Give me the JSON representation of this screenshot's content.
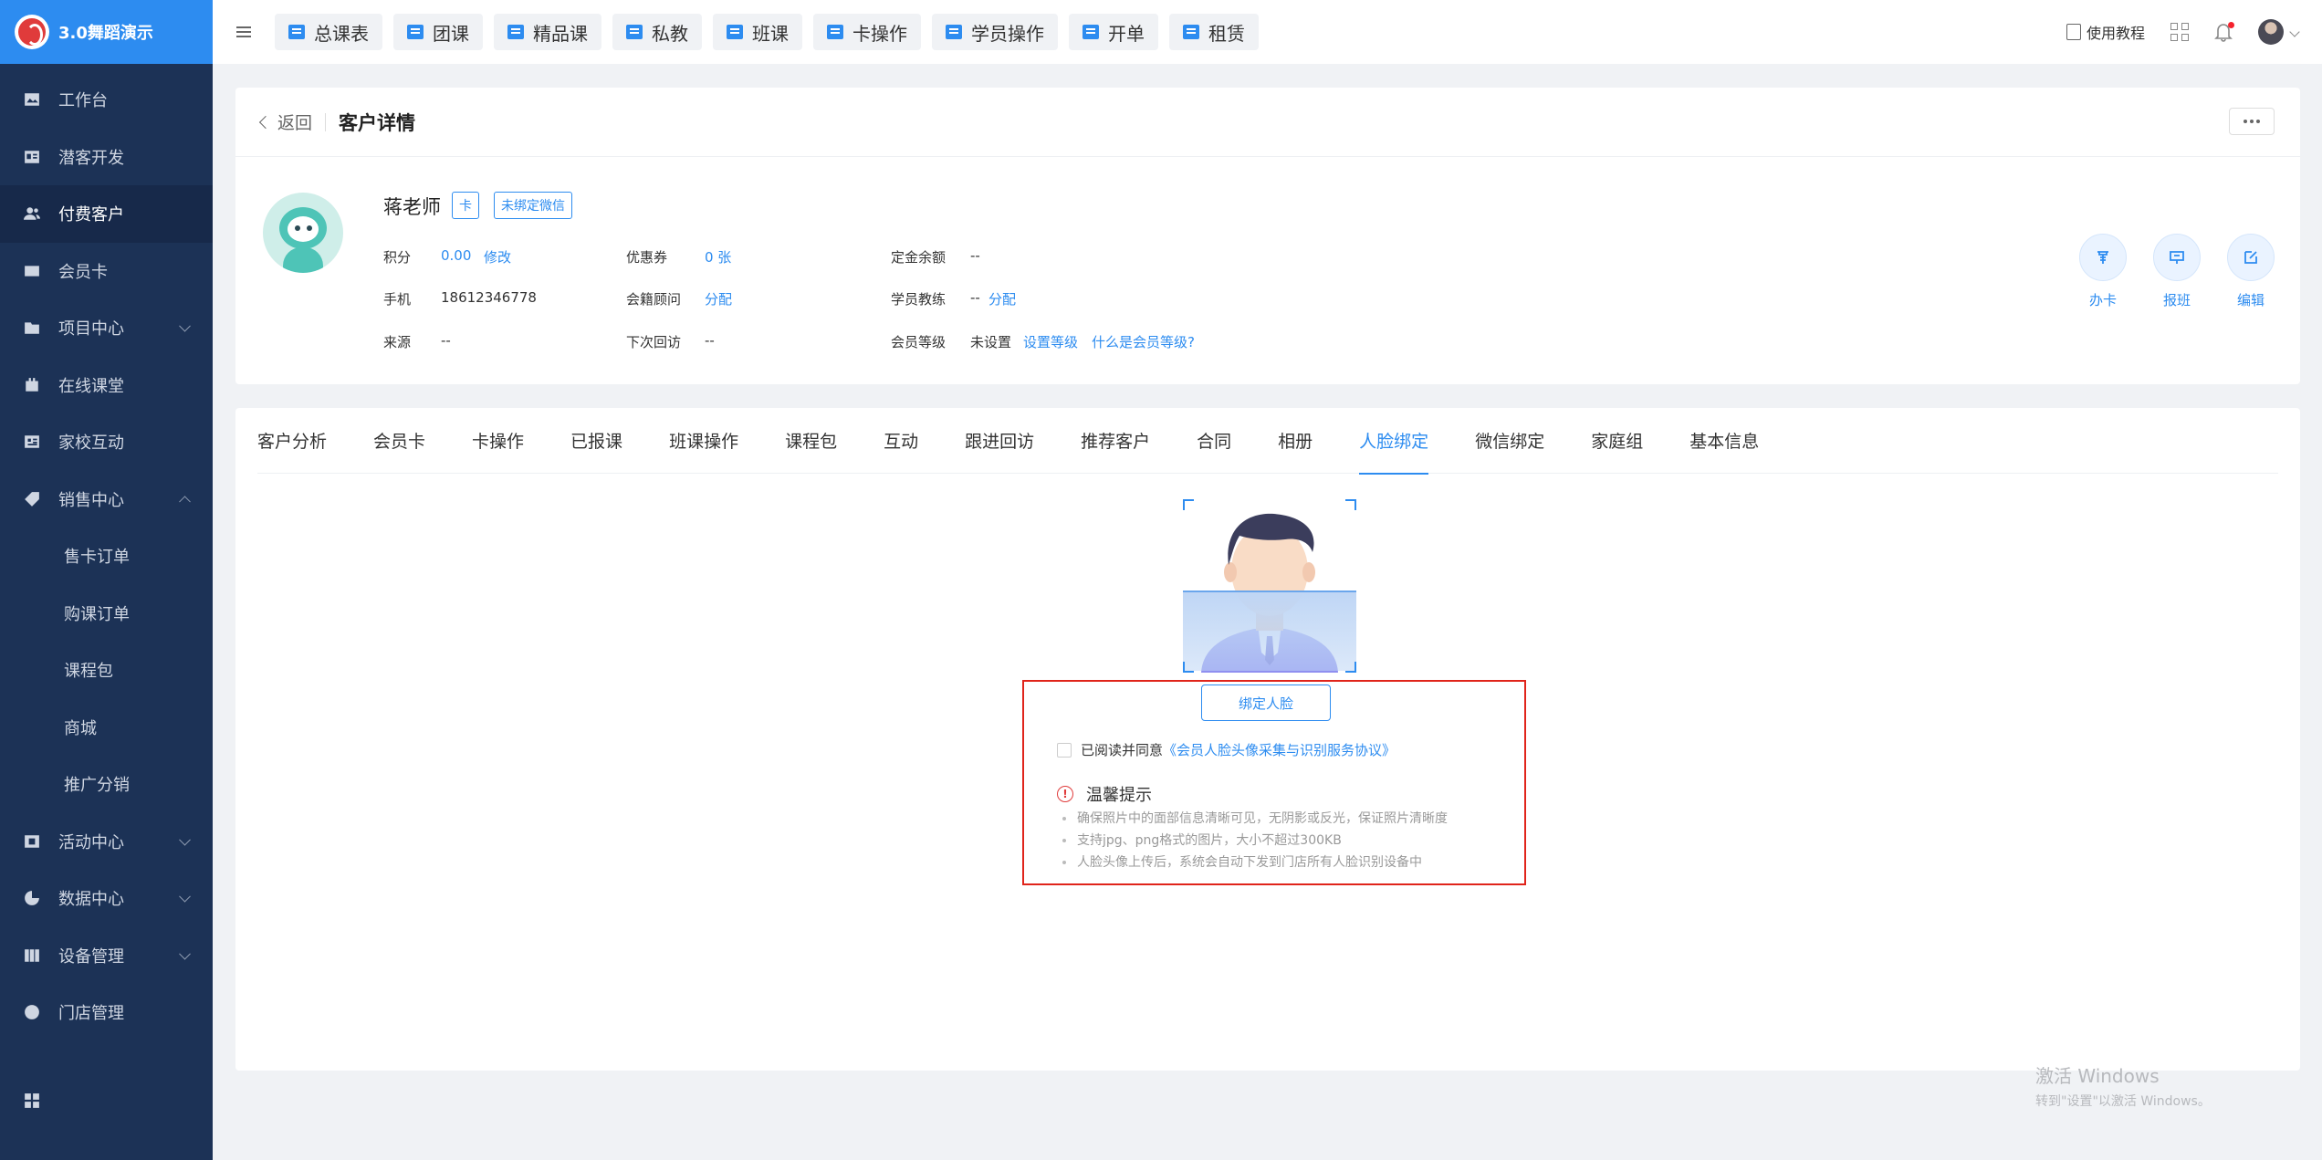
{
  "brand": {
    "title": "3.0舞蹈演示"
  },
  "sidebar": {
    "items": [
      {
        "label": "工作台",
        "icon": "image-icon",
        "active": false
      },
      {
        "label": "潜客开发",
        "icon": "id-card-icon",
        "active": false
      },
      {
        "label": "付费客户",
        "icon": "users-icon",
        "active": true
      },
      {
        "label": "会员卡",
        "icon": "card-icon",
        "active": false
      },
      {
        "label": "项目中心",
        "icon": "folder-icon",
        "active": false,
        "expandable": true
      },
      {
        "label": "在线课堂",
        "icon": "video-icon",
        "active": false
      },
      {
        "label": "家校互动",
        "icon": "contact-icon",
        "active": false
      },
      {
        "label": "销售中心",
        "icon": "tag-icon",
        "active": false,
        "expanded": true
      }
    ],
    "sales_sub": [
      "售卡订单",
      "购课订单",
      "课程包",
      "商城",
      "推广分销"
    ],
    "items2": [
      {
        "label": "活动中心",
        "icon": "activity-icon"
      },
      {
        "label": "数据中心",
        "icon": "pie-chart-icon"
      },
      {
        "label": "设备管理",
        "icon": "device-icon"
      },
      {
        "label": "门店管理",
        "icon": "store-icon"
      }
    ]
  },
  "topbar": {
    "quick": [
      "总课表",
      "团课",
      "精品课",
      "私教",
      "班课",
      "卡操作",
      "学员操作",
      "开单",
      "租赁"
    ],
    "guide": "使用教程"
  },
  "detail": {
    "back": "返回",
    "title": "客户详情",
    "name": "蒋老师",
    "tag_card": "卡",
    "tag_wechat": "未绑定微信",
    "points_label": "积分",
    "points_value": "0.00",
    "points_edit": "修改",
    "coupon_label": "优惠券",
    "coupon_value": "0 张",
    "deposit_label": "定金余额",
    "deposit_value": "--",
    "phone_label": "手机",
    "phone_value": "18612346778",
    "advisor_label": "会籍顾问",
    "advisor_action": "分配",
    "coach_label": "学员教练",
    "coach_value": "--",
    "coach_action": "分配",
    "source_label": "来源",
    "source_value": "--",
    "revisit_label": "下次回访",
    "revisit_value": "--",
    "level_label": "会员等级",
    "level_value": "未设置",
    "level_set": "设置等级",
    "level_help": "什么是会员等级?",
    "ops": [
      "办卡",
      "报班",
      "编辑"
    ]
  },
  "tabs": [
    "客户分析",
    "会员卡",
    "卡操作",
    "已报课",
    "班课操作",
    "课程包",
    "互动",
    "跟进回访",
    "推荐客户",
    "合同",
    "相册",
    "人脸绑定",
    "微信绑定",
    "家庭组",
    "基本信息"
  ],
  "active_tab": "人脸绑定",
  "face": {
    "bind_button": "绑定人脸",
    "agree_prefix": "已阅读并同意",
    "agree_link": "《会员人脸头像采集与识别服务协议》",
    "tip_title": "温馨提示",
    "tips": [
      "确保照片中的面部信息清晰可见，无阴影或反光，保证照片清晰度",
      "支持jpg、png格式的图片，大小不超过300KB",
      "人脸头像上传后，系统会自动下发到门店所有人脸识别设备中"
    ]
  },
  "watermark": {
    "line1": "激活 Windows",
    "line2": "转到\"设置\"以激活 Windows。"
  },
  "colors": {
    "primary": "#2d8cf0",
    "sidebar": "#1c3256",
    "danger": "#e0241b"
  }
}
